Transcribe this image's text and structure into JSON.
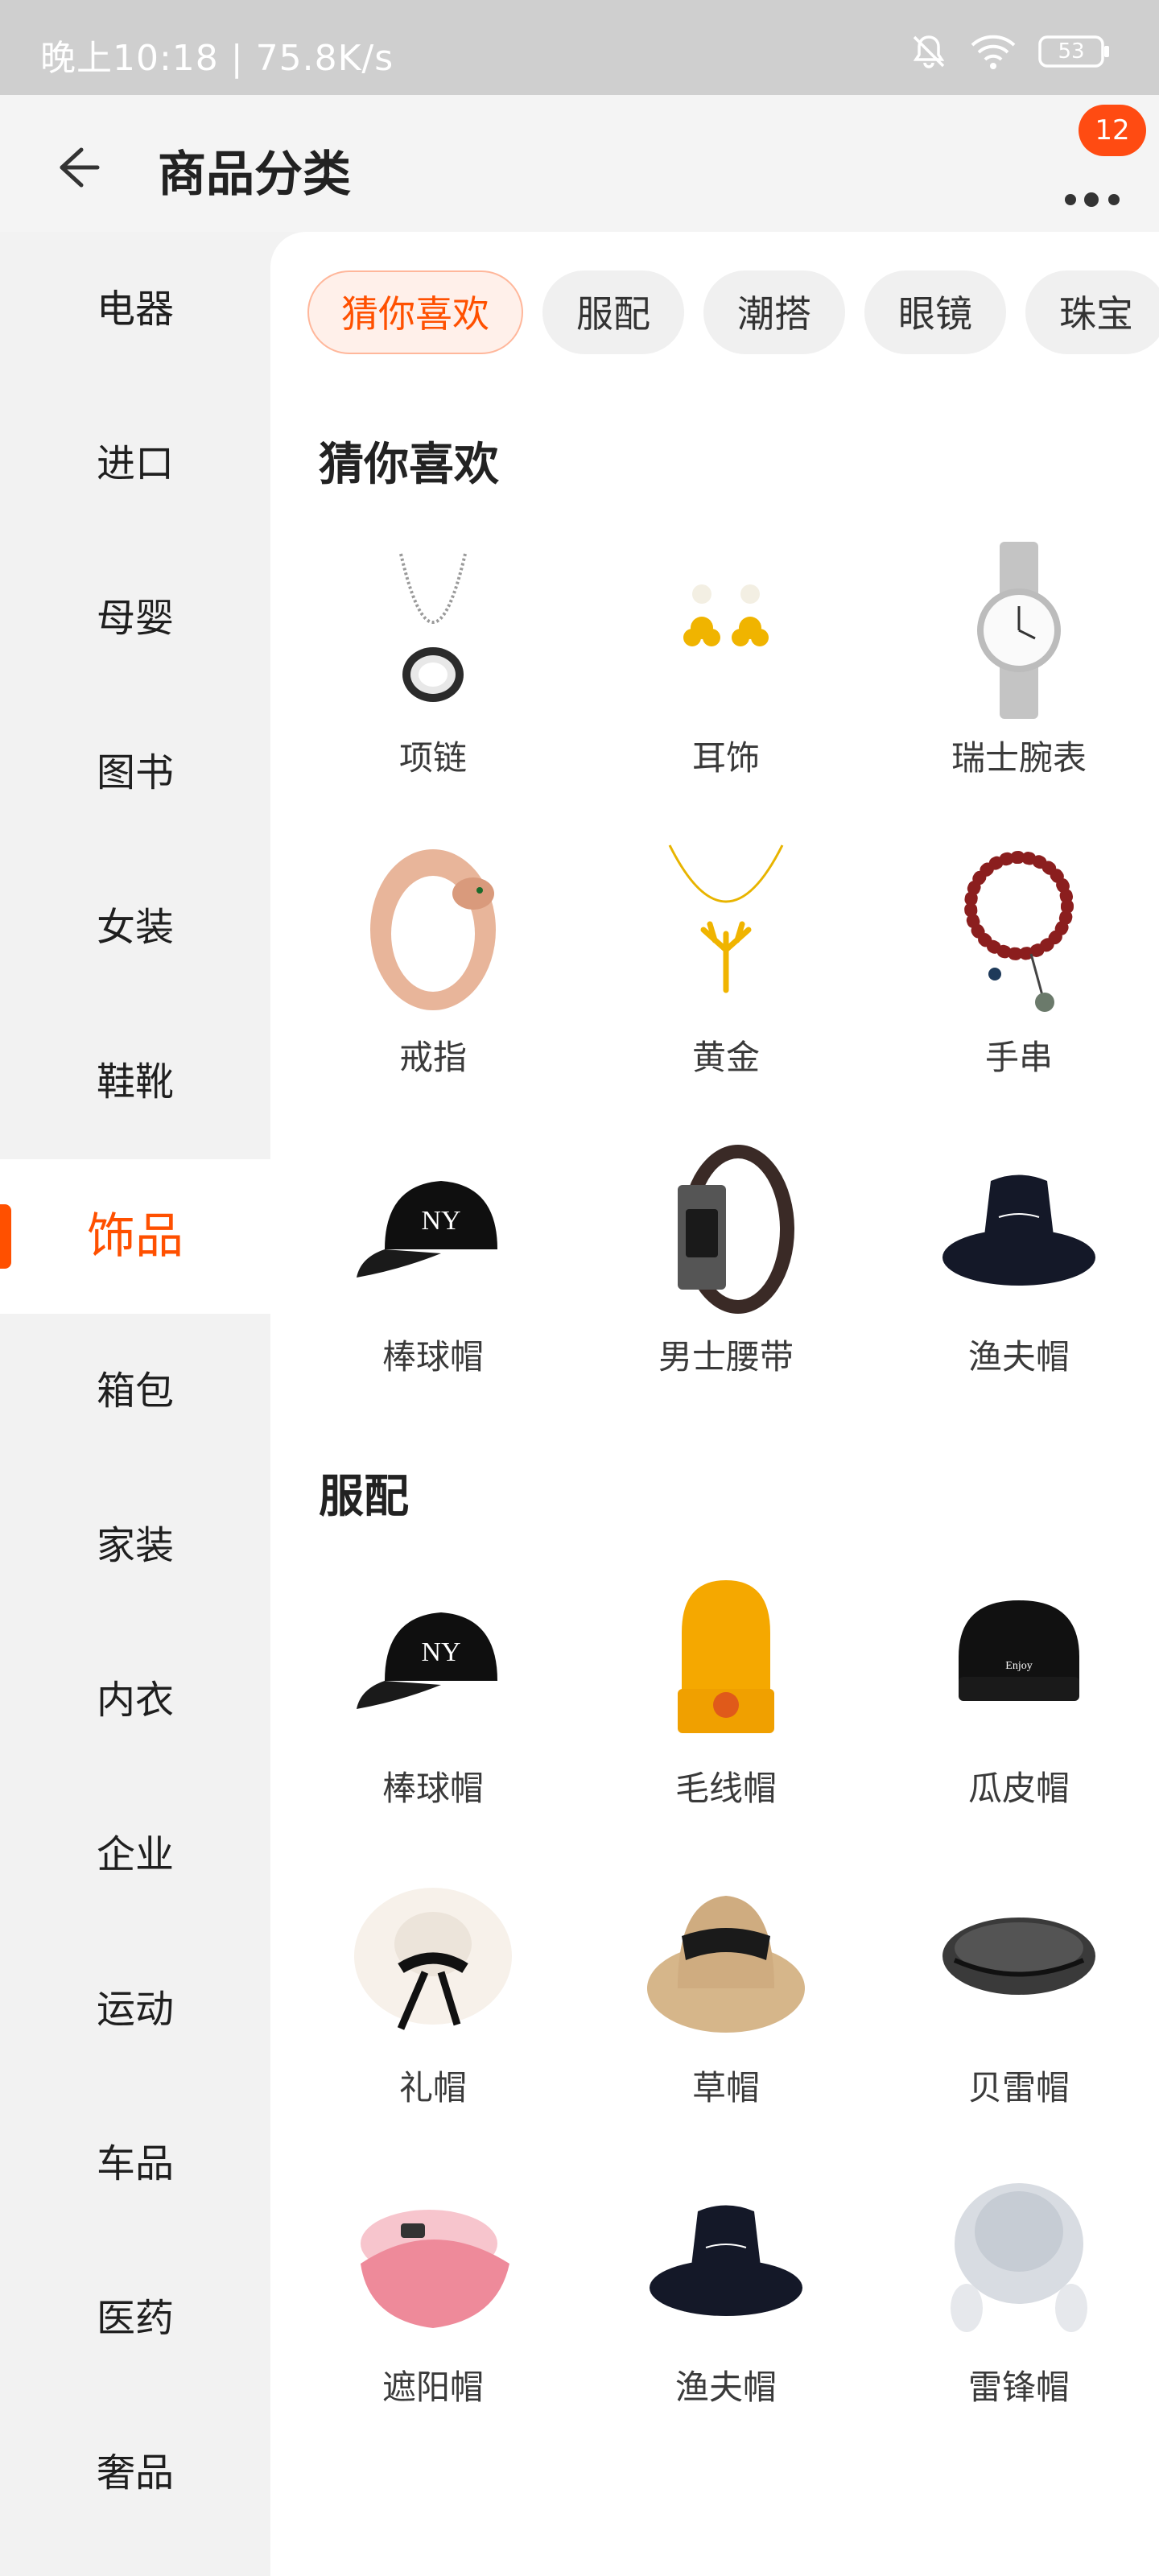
{
  "status_bar": {
    "time_speed": "晚上10:18 | 75.8K/s",
    "battery": "53"
  },
  "header": {
    "title": "商品分类",
    "badge_count": "12"
  },
  "sidebar": {
    "items": [
      "电器",
      "进口",
      "母婴",
      "图书",
      "女装",
      "鞋靴",
      "饰品",
      "箱包",
      "家装",
      "内衣",
      "企业",
      "运动",
      "车品",
      "医药",
      "奢品"
    ],
    "active": "饰品"
  },
  "tabs": [
    "猜你喜欢",
    "服配",
    "潮搭",
    "眼镜",
    "珠宝"
  ],
  "sections": [
    {
      "title": "猜你喜欢",
      "items": [
        {
          "label": "项链",
          "icon": "necklace-icon"
        },
        {
          "label": "耳饰",
          "icon": "earring-icon"
        },
        {
          "label": "瑞士腕表",
          "icon": "watch-icon"
        },
        {
          "label": "戒指",
          "icon": "ring-icon"
        },
        {
          "label": "黄金",
          "icon": "gold-necklace-icon"
        },
        {
          "label": "手串",
          "icon": "bead-bracelet-icon"
        },
        {
          "label": "棒球帽",
          "icon": "baseball-cap-icon"
        },
        {
          "label": "男士腰带",
          "icon": "belt-icon"
        },
        {
          "label": "渔夫帽",
          "icon": "bucket-hat-icon"
        }
      ]
    },
    {
      "title": "服配",
      "items": [
        {
          "label": "棒球帽",
          "icon": "baseball-cap-icon"
        },
        {
          "label": "毛线帽",
          "icon": "beanie-icon"
        },
        {
          "label": "瓜皮帽",
          "icon": "skullcap-icon"
        },
        {
          "label": "礼帽",
          "icon": "wide-brim-hat-icon"
        },
        {
          "label": "草帽",
          "icon": "straw-hat-icon"
        },
        {
          "label": "贝雷帽",
          "icon": "beret-icon"
        },
        {
          "label": "遮阳帽",
          "icon": "sun-visor-icon"
        },
        {
          "label": "渔夫帽",
          "icon": "bucket-hat-icon"
        },
        {
          "label": "雷锋帽",
          "icon": "fur-hat-icon"
        }
      ]
    }
  ],
  "colors": {
    "accent": "#ff5000",
    "badge": "#ff4b12"
  }
}
